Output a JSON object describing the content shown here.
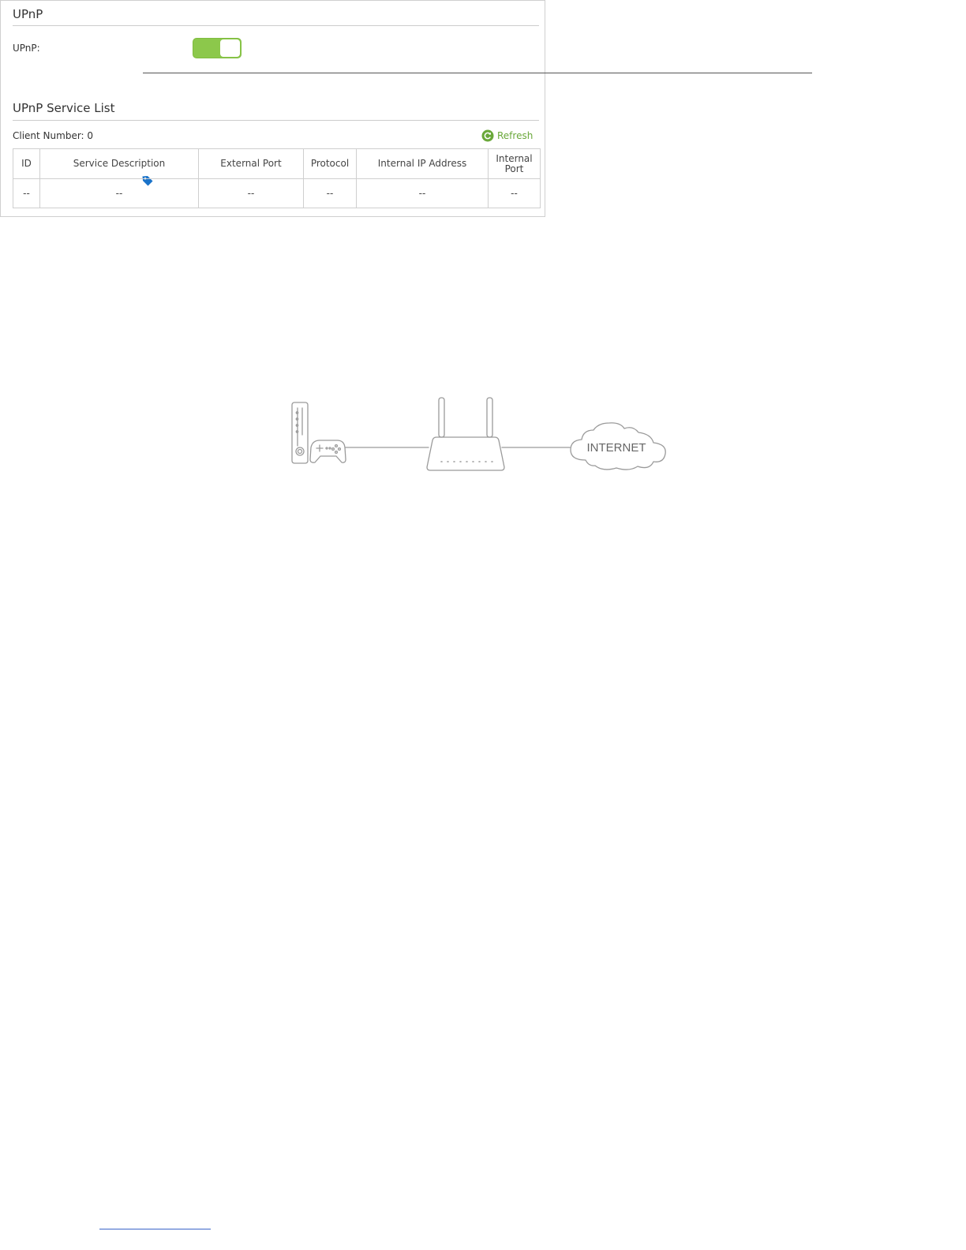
{
  "diagram": {
    "cloud_label": "INTERNET"
  },
  "upnp_panel": {
    "title": "UPnP",
    "toggle_label": "UPnP:",
    "toggle_state": "on",
    "service_list_title": "UPnP Service List",
    "client_number_label": "Client Number: 0",
    "refresh_label": "Refresh",
    "table": {
      "headers": [
        "ID",
        "Service Description",
        "External Port",
        "Protocol",
        "Internal IP Address",
        "Internal Port"
      ],
      "rows": [
        [
          "--",
          "--",
          "--",
          "--",
          "--",
          "--"
        ]
      ]
    }
  },
  "colors": {
    "toggle_on": "#8cc84b",
    "refresh_green": "#6aa83a",
    "tag_icon": "#1a73c9"
  }
}
